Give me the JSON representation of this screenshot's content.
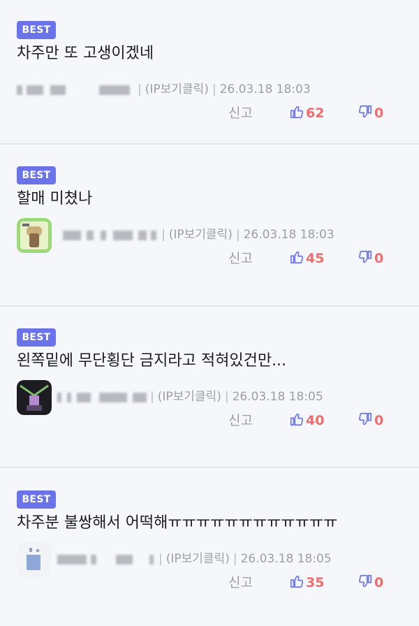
{
  "comments": [
    {
      "badge": "BEST",
      "text": "차주만 또 고생이겠네",
      "ip_label": "(IP보기클릭)",
      "timestamp": "26.03.18 18:03",
      "report_label": "신고",
      "likes": "62",
      "dislikes": "0",
      "has_avatar": false
    },
    {
      "badge": "BEST",
      "text": "할매 미쳤나",
      "ip_label": "(IP보기클릭)",
      "timestamp": "26.03.18 18:03",
      "report_label": "신고",
      "likes": "45",
      "dislikes": "0",
      "has_avatar": true
    },
    {
      "badge": "BEST",
      "text": "왼쪽밑에 무단횡단 금지라고 적혀있건만...",
      "ip_label": "(IP보기클릭)",
      "timestamp": "26.03.18 18:05",
      "report_label": "신고",
      "likes": "40",
      "dislikes": "0",
      "has_avatar": true
    },
    {
      "badge": "BEST",
      "text": "차주분 불쌍해서 어떡해ㅠㅠㅠㅠㅠㅠㅠㅠㅠㅠㅠㅠ",
      "ip_label": "(IP보기클릭)",
      "timestamp": "26.03.18 18:05",
      "report_label": "신고",
      "likes": "35",
      "dislikes": "0",
      "has_avatar": true
    }
  ],
  "icons": {
    "like": "thumbs-up-icon",
    "dislike": "thumbs-down-icon"
  },
  "colors": {
    "badge": "#6a73ea",
    "count": "#f36b6b",
    "icon": "#6a73ea",
    "meta": "#9c9ea8",
    "background": "#f6f7fb"
  }
}
